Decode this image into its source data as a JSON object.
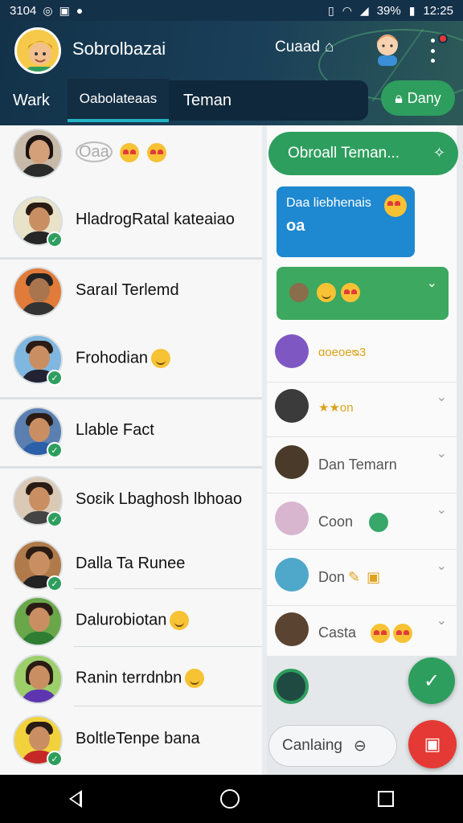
{
  "status_bar": {
    "time_left": "3104",
    "battery": "39%",
    "time_right": "12:25"
  },
  "header": {
    "title": "Sobrolbazai",
    "secondary_label": "Cuaad",
    "tabs": [
      {
        "label": "Wark"
      },
      {
        "label": "Oabolateaas"
      },
      {
        "label": "Teman"
      }
    ],
    "action_button": "Dany"
  },
  "contacts": [
    {
      "name": "Oaa",
      "emoji": [
        "heart-eyes",
        "heart-eyes"
      ],
      "verified": false
    },
    {
      "name": "HladrogRatal kateaiao",
      "emoji": [],
      "verified": true
    },
    {
      "name": "Saraıl Terlemd",
      "emoji": [],
      "verified": false
    },
    {
      "name": "Frohodian",
      "emoji": [
        "smile"
      ],
      "verified": true
    },
    {
      "name": "Llable Fact",
      "emoji": [],
      "verified": true
    },
    {
      "name": "Soɛik Lbaghosh lbhoao",
      "emoji": [],
      "verified": true
    },
    {
      "name": "Dalla Ta Runee",
      "emoji": [],
      "verified": true
    },
    {
      "name": "Dalurobiotan",
      "emoji": [
        "smile"
      ],
      "verified": false
    },
    {
      "name": "Ranin terrdnbn",
      "emoji": [
        "smile"
      ],
      "verified": false
    },
    {
      "name": "BoltleTenpe bana",
      "emoji": [],
      "verified": true
    }
  ],
  "right_panel": {
    "pill_label": "Obroall Teman...",
    "blue_bubble": {
      "line1": "Daa liebhenais",
      "line2": "oa"
    },
    "rows": [
      {
        "label": "ɑoeoeᴓ3",
        "label_color": "#d9a21b"
      },
      {
        "label": "★★on",
        "label_color": "#d9a21b"
      },
      {
        "label": "Dan Temarn",
        "label_color": "#666666"
      },
      {
        "label": "Coon",
        "label_color": "#666666"
      },
      {
        "label": "Don",
        "label_color": "#666666"
      },
      {
        "label": "Casta",
        "label_color": "#666666"
      }
    ],
    "compose_label": "Canlaing"
  },
  "colors": {
    "header_bg": "#123249",
    "accent_green": "#2e9e5e",
    "accent_blue": "#1e88d0",
    "fab_red": "#e53935",
    "tab_indicator": "#22b3c4"
  }
}
